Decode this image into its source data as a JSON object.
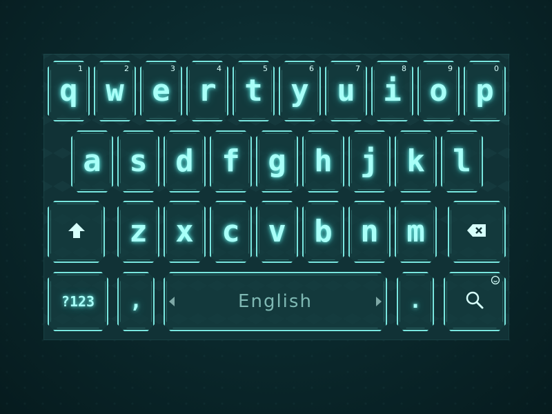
{
  "keyboard": {
    "row1": [
      {
        "char": "q",
        "hint": "1"
      },
      {
        "char": "w",
        "hint": "2"
      },
      {
        "char": "e",
        "hint": "3"
      },
      {
        "char": "r",
        "hint": "4"
      },
      {
        "char": "t",
        "hint": "5"
      },
      {
        "char": "y",
        "hint": "6"
      },
      {
        "char": "u",
        "hint": "7"
      },
      {
        "char": "i",
        "hint": "8"
      },
      {
        "char": "o",
        "hint": "9"
      },
      {
        "char": "p",
        "hint": "0"
      }
    ],
    "row2": [
      "a",
      "s",
      "d",
      "f",
      "g",
      "h",
      "j",
      "k",
      "l"
    ],
    "row3": [
      "z",
      "x",
      "c",
      "v",
      "b",
      "n",
      "m"
    ],
    "symbols_label": "?123",
    "comma_label": ",",
    "space_label": "English",
    "period_label": ".",
    "shift_icon": "shift-arrow-icon",
    "backspace_icon": "backspace-icon",
    "search_icon": "search-icon",
    "emoji_icon": "emoji-icon"
  },
  "colors": {
    "accent": "#79e6df",
    "key_text": "#a8fff8",
    "background": "#0b2a2e"
  }
}
